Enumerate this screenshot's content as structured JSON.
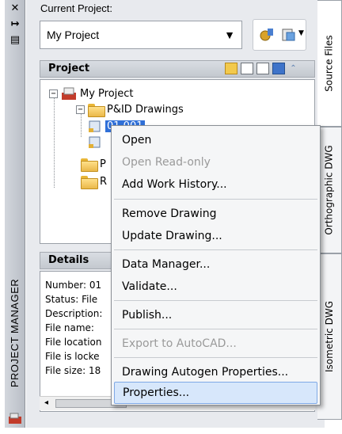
{
  "palette": {
    "title": "PROJECT MANAGER",
    "close_glyph": "✕",
    "pin_glyph": "↦",
    "props_glyph": "▤"
  },
  "current_project": {
    "label": "Current Project:",
    "value": "My Project"
  },
  "project_section": {
    "title": "Project",
    "tree": {
      "root": "My Project",
      "folder": "P&ID Drawings",
      "selected": "01.001",
      "folder2": "P",
      "folder3": "R"
    }
  },
  "details_section": {
    "title": "Details",
    "lines": [
      "Number: 01",
      "Status: File",
      "Description:",
      "File name:",
      "File location",
      "File is locke",
      "File size: 18"
    ]
  },
  "side_tabs": [
    "Source Files",
    "Orthographic DWG",
    "Isometric DWG"
  ],
  "context_menu": {
    "items": [
      {
        "label": "Open",
        "enabled": true
      },
      {
        "label": "Open Read-only",
        "enabled": false
      },
      {
        "label": "Add Work History...",
        "enabled": true
      },
      {
        "label": "Remove Drawing",
        "enabled": true
      },
      {
        "label": "Update Drawing...",
        "enabled": true
      },
      {
        "label": "Data Manager...",
        "enabled": true
      },
      {
        "label": "Validate...",
        "enabled": true
      },
      {
        "label": "Publish...",
        "enabled": true
      },
      {
        "label": "Export to AutoCAD...",
        "enabled": false
      },
      {
        "label": "Drawing Autogen Properties...",
        "enabled": true
      },
      {
        "label": "Properties...",
        "enabled": true
      }
    ]
  },
  "colors": {
    "selection": "#3070d8",
    "menu_hover": "#d7e7fb",
    "folder": "#eab84a"
  }
}
